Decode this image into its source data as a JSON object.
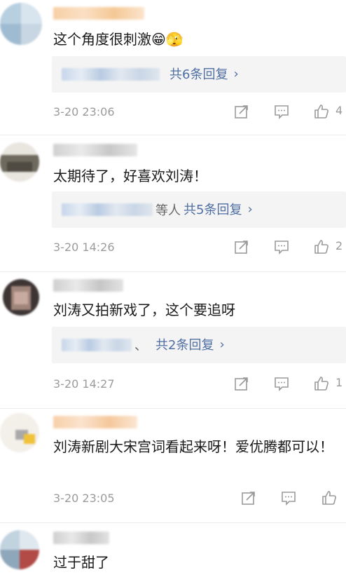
{
  "comments": [
    {
      "text": "这个角度很刺激😁🫣",
      "reply_suffix": "",
      "reply_link": "共6条回复",
      "date": "3-20 23:06",
      "like_count": "4"
    },
    {
      "text": "太期待了，好喜欢刘涛！",
      "reply_suffix": "等人",
      "reply_link": "共5条回复",
      "date": "3-20 14:26",
      "like_count": "2"
    },
    {
      "text": "刘涛又拍新戏了，这个要追呀",
      "reply_suffix": "、",
      "reply_link": "共2条回复",
      "date": "3-20 14:27",
      "like_count": "1"
    },
    {
      "text": "刘涛新剧大宋宫词看起来呀！爱优腾都可以！",
      "reply_suffix": "",
      "reply_link": "",
      "date": "3-20 23:05",
      "like_count": ""
    },
    {
      "text": "过于甜了",
      "reply_suffix": "",
      "reply_link": "",
      "date": "",
      "like_count": ""
    }
  ],
  "icons": {
    "share": "share-icon",
    "comment": "comment-icon",
    "like": "thumbs-up-icon",
    "reply_chevron": "chevron-right-icon"
  },
  "colors": {
    "link": "#4e6ea3",
    "meta": "#9b9b9b",
    "reply_bg": "#f4f4f4"
  }
}
